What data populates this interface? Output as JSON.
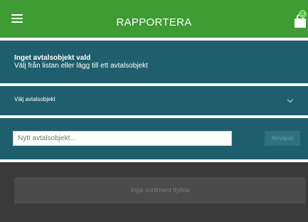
{
  "header": {
    "title": "RAPPORTERA",
    "cart_count": "0",
    "menu_icon": "hamburger-icon",
    "cart_icon": "shopping-bag-icon",
    "color": "#3f9b33"
  },
  "contract_status": {
    "title": "Inget avtalsobjekt vald",
    "subtitle": "Välj från listan eller lägg till ett avtalsobjekt"
  },
  "contract_select": {
    "selected_label": "Välj avtalsobjekt",
    "chevron_icon": "chevron-down-icon"
  },
  "new_contract": {
    "value": "",
    "placeholder": "Nytt avtalsobjekt...",
    "button_label": "Använd"
  },
  "assortment": {
    "empty_label": "Inga sortiment ifyllda"
  },
  "colors": {
    "panel": "#1f5f6d",
    "bottom": "#3a3a3a"
  }
}
